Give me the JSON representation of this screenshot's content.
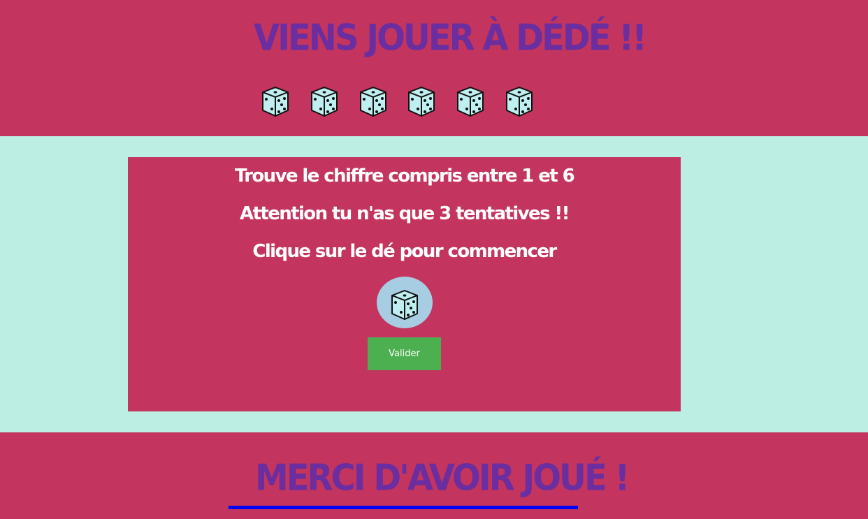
{
  "header": {
    "title": "VIENS JOUER À DÉDÉ !!",
    "dice_icon": "dice-icon",
    "dice_count": 6
  },
  "game": {
    "instruction_1": "Trouve le chiffre compris entre 1 et 6",
    "instruction_2": "Attention tu n'as que 3 tentatives !!",
    "instruction_3": "Clique sur le dé pour commencer",
    "die_button_icon": "dice-icon",
    "validate_label": "Valider"
  },
  "footer": {
    "title": "MERCI D'AVOIR JOUÉ !"
  },
  "colors": {
    "header_bg": "#c3345e",
    "title": "#6a2ea0",
    "main_bg": "#bdeee3",
    "card_bg": "#c3345e",
    "die_button_bg": "#a7cde2",
    "die_face": "#bfeff0",
    "validate_bg": "#4cb050",
    "footer_rule": "#0000ff"
  }
}
